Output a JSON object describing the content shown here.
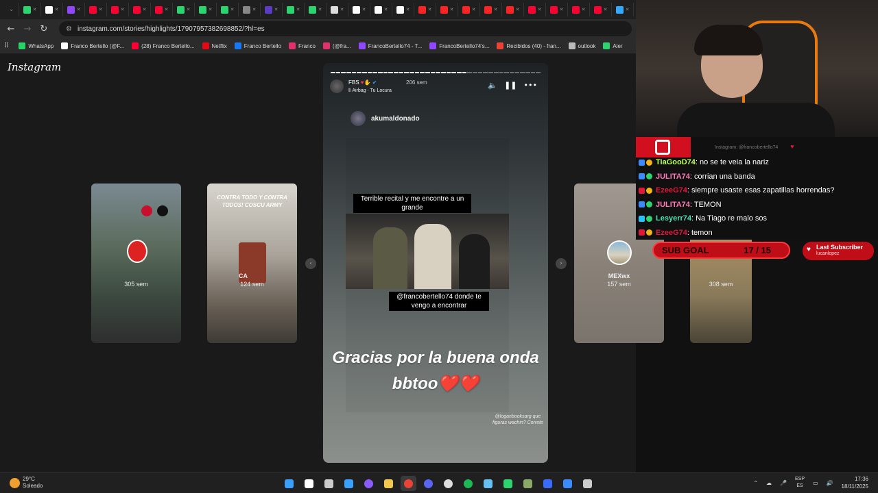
{
  "browser": {
    "tabs": [
      {
        "color": "#2dd36f"
      },
      {
        "color": "#ffffff"
      },
      {
        "color": "#9146ff"
      },
      {
        "color": "#ff0033"
      },
      {
        "color": "#ff0033"
      },
      {
        "color": "#ff0033"
      },
      {
        "color": "#ff0033"
      },
      {
        "color": "#2dd36f"
      },
      {
        "color": "#2dd36f"
      },
      {
        "color": "#2dd36f"
      },
      {
        "color": "#888888"
      },
      {
        "color": "#5b3cc4"
      },
      {
        "color": "#2dd36f"
      },
      {
        "color": "#2dd36f"
      },
      {
        "color": "#dddddd"
      },
      {
        "color": "#ffffff"
      },
      {
        "color": "#ffffff"
      },
      {
        "color": "#ffffff"
      },
      {
        "color": "#ff2222"
      },
      {
        "color": "#ff2222"
      },
      {
        "color": "#ff2222"
      },
      {
        "color": "#ff2222"
      },
      {
        "color": "#ff2222"
      },
      {
        "color": "#ff0033"
      },
      {
        "color": "#ff0033"
      },
      {
        "color": "#ff0033"
      },
      {
        "color": "#ff0033"
      },
      {
        "color": "#33aaff"
      }
    ],
    "url": "instagram.com/stories/highlights/17907957382698852/?hl=es",
    "bookmarks": [
      {
        "label": "WhatsApp",
        "color": "#25d366"
      },
      {
        "label": "Franco Bertello (@F...",
        "color": "#ffffff"
      },
      {
        "label": "(28) Franco Bertello...",
        "color": "#ff0033"
      },
      {
        "label": "Netflix",
        "color": "#e50914"
      },
      {
        "label": "Franco Bertello",
        "color": "#1877f2"
      },
      {
        "label": "Franco",
        "color": "#e1306c"
      },
      {
        "label": "(@fra...",
        "color": "#e1306c"
      },
      {
        "label": "FrancoBertello74 - T...",
        "color": "#9146ff"
      },
      {
        "label": "FrancoBertello74's...",
        "color": "#9146ff"
      },
      {
        "label": "Recibidos (40) - fran...",
        "color": "#ea4335"
      },
      {
        "label": "outlook",
        "color": "#bbbbbb"
      },
      {
        "label": "Aler",
        "color": "#2dd36f"
      }
    ]
  },
  "instagram": {
    "logo": "Instagram",
    "cards": [
      {
        "label": "305 sem",
        "bg": "linear-gradient(180deg,#7b8a92 0%,#5a6b5c 40%,#3c4a40 70%,#2e2e2e 100%)"
      },
      {
        "label": "124 sem",
        "caption": "CONTRA TODO Y CONTRA TODOS! COSCU ARMY",
        "name": "CA",
        "bg": "linear-gradient(180deg,#d8d5ce 0%,#a9a39a 45%,#6b6258 75%,#3e3a35 100%)"
      },
      {
        "label": "157 sem",
        "name": "MEXwx",
        "bg": "linear-gradient(180deg,#a09991 0%,#8a8279 50%,#7a746c 100%)"
      },
      {
        "label": "308 sem",
        "bg": "linear-gradient(180deg,#c8c2b6 0%,#a38b62 40%,#8a7a5a 70%,#4a4436 100%)"
      }
    ],
    "story": {
      "user": "FBS",
      "time": "206 sem",
      "song": "Airbag · Tu Locura",
      "repost_user": "akumaldonado",
      "caption_top": "Terrible recital y me encontre a un grande",
      "caption_bottom": "@francobertello74 donde te vengo a encontrar",
      "big_text": "Gracias por la buena onda bbtoo❤️❤️",
      "mention": "@loganbooksarg que figuras wachin? Correte"
    }
  },
  "stream": {
    "chat_header": "Instagram: @francobertello74",
    "chat": [
      {
        "name": "TiaGooD74",
        "msg": ": no se te veia la nariz",
        "color": "#b9ff5a",
        "b1": "#3a8bff",
        "b2": "#f2b416"
      },
      {
        "name": "JULITA74",
        "msg": ": corrian una banda",
        "color": "#ff7ab8",
        "b1": "#3a8bff",
        "b2": "#2dd36f"
      },
      {
        "name": "EzeeG74",
        "msg": ": siempre usaste esas zapatillas horrendas?",
        "color": "#e0183a",
        "b1": "#e0183a",
        "b2": "#f2b416"
      },
      {
        "name": "JULITA74",
        "msg": ": TEMON",
        "color": "#ff7ab8",
        "b1": "#3a8bff",
        "b2": "#2dd36f"
      },
      {
        "name": "Lesyerr74",
        "msg": ": Na Tiago re malo sos",
        "color": "#4ce0b3",
        "b1": "#23c4ff",
        "b2": "#2dd36f"
      },
      {
        "name": "EzeeG74",
        "msg": ": temon",
        "color": "#e0183a",
        "b1": "#e0183a",
        "b2": "#f2b416"
      }
    ],
    "sub_goal_label": "SUB GOAL",
    "sub_goal_value": "17 / 15",
    "last_sub_label": "Last Subscriber",
    "last_sub_user": "lucanlopez"
  },
  "taskbar": {
    "temp": "29°C",
    "weather": "Soleado",
    "lang": "ESP",
    "lang2": "ES",
    "time": "17:36",
    "date": "18/11/2025",
    "apps": [
      {
        "name": "windows-start",
        "color": "#3aa0ff"
      },
      {
        "name": "search",
        "color": "#ffffff"
      },
      {
        "name": "task-view",
        "color": "#cccccc"
      },
      {
        "name": "store",
        "color": "#3aa0ff"
      },
      {
        "name": "cortana",
        "color": "#8a5cff"
      },
      {
        "name": "file-explorer",
        "color": "#f2c94c"
      },
      {
        "name": "chrome",
        "color": "#ea4335"
      },
      {
        "name": "discord",
        "color": "#5865f2"
      },
      {
        "name": "obs",
        "color": "#dddddd"
      },
      {
        "name": "spotify",
        "color": "#1db954"
      },
      {
        "name": "steam",
        "color": "#66c0f4"
      },
      {
        "name": "app-green",
        "color": "#2dd36f"
      },
      {
        "name": "app-tools",
        "color": "#88aa66"
      },
      {
        "name": "app-display",
        "color": "#3a6bff"
      },
      {
        "name": "app-m",
        "color": "#3a8bff"
      },
      {
        "name": "calculator",
        "color": "#cccccc"
      }
    ]
  }
}
